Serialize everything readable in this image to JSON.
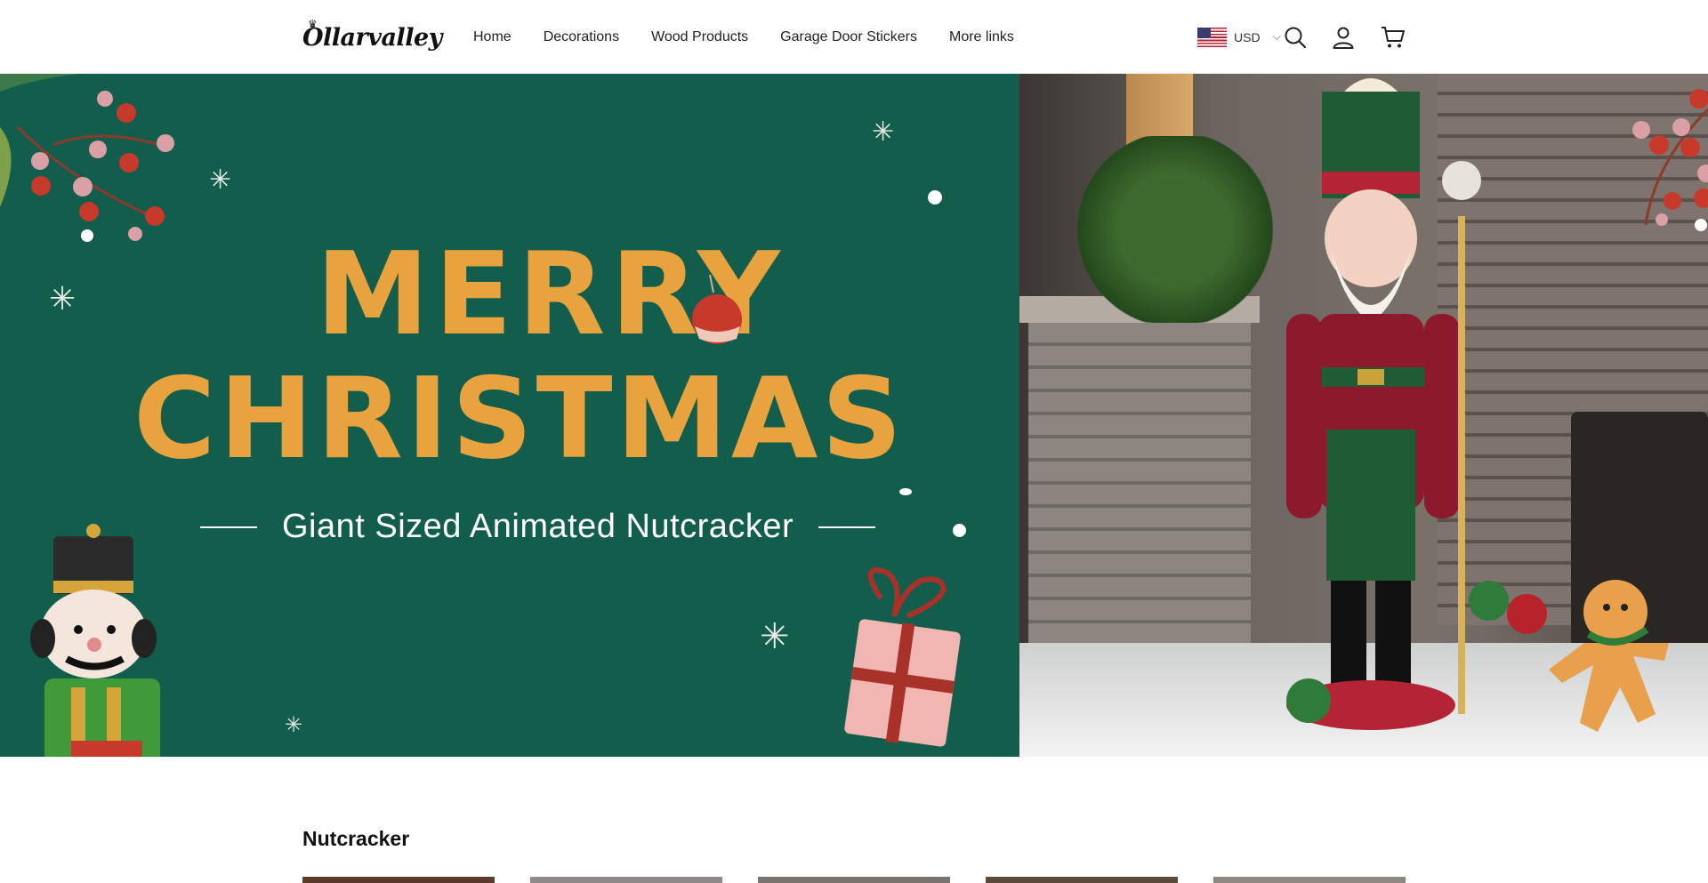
{
  "header": {
    "logo_text": "Ollarvalley",
    "nav": [
      "Home",
      "Decorations",
      "Wood Products",
      "Garage Door Stickers",
      "More links"
    ],
    "currency": "USD"
  },
  "banner": {
    "headline_1": "MERRY",
    "headline_2": "CHRISTMAS",
    "tagline": "Giant Sized Animated Nutcracker",
    "colors": {
      "green": "#135d4d",
      "gold": "#e8a33f"
    }
  },
  "section": {
    "title": "Nutcracker"
  }
}
